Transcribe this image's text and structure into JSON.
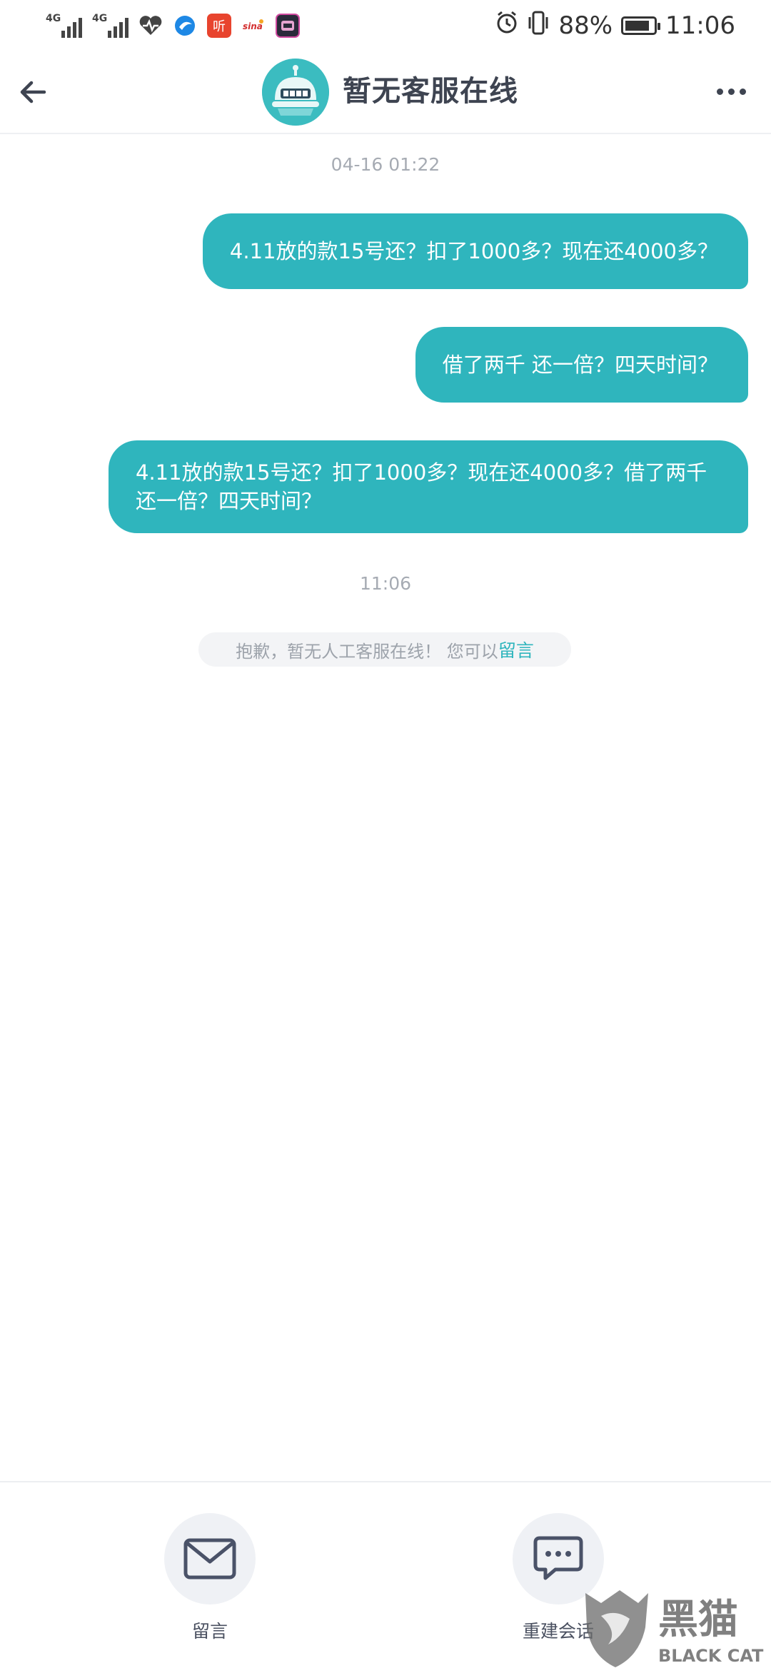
{
  "status_bar": {
    "signal_1_label": "4G",
    "signal_2_label": "4G",
    "battery_percent": "88%",
    "battery_level": 0.88,
    "time": "11:06",
    "icons": [
      "heart-icon",
      "browser-icon",
      "ting-app-icon",
      "sina-icon",
      "game-app-icon",
      "alarm-icon",
      "vibrate-icon"
    ],
    "ting_app_label": "听"
  },
  "header": {
    "title": "暂无客服在线"
  },
  "chat": {
    "timestamp_1": "04-16 01:22",
    "messages": [
      {
        "lines": [
          "4.11放的款15号还？扣了1000多？现在还4000多？"
        ]
      },
      {
        "lines": [
          "借了两千 还一倍？四天时间？"
        ]
      },
      {
        "lines": [
          "4.11放的款15号还？扣了1000多？现在还4000多？借了两千",
          "还一倍？四天时间？"
        ]
      }
    ],
    "timestamp_2": "11:06",
    "system_notice": "抱歉，暂无人工客服在线！ 您可以",
    "system_link": "留言"
  },
  "bottom": {
    "leave_message_label": "留言",
    "new_session_label": "重建会话"
  },
  "watermark": {
    "cn": "黑猫",
    "en": "BLACK CAT"
  },
  "colors": {
    "accent": "#2fb5bd",
    "title": "#3e4451",
    "muted": "#a6abb3"
  }
}
